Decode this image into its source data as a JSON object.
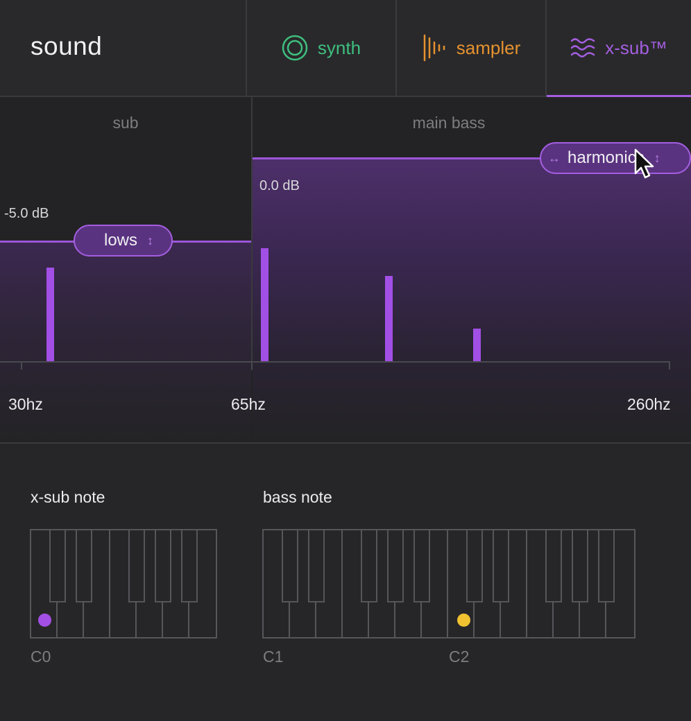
{
  "header": {
    "title": "sound",
    "tabs": [
      {
        "label": "synth",
        "icon": "concentric-circles-icon",
        "color": "#3fbf7f"
      },
      {
        "label": "sampler",
        "icon": "waveform-bars-icon",
        "color": "#e5922f"
      },
      {
        "label": "x-sub™",
        "icon": "waves-icon",
        "color": "#a45ee0",
        "active": true
      }
    ]
  },
  "spectrum": {
    "zones": {
      "sub": "sub",
      "main": "main bass"
    },
    "sub_level": "-5.0 dB",
    "main_level": "0.0 dB",
    "sub_handle": {
      "label": "lows",
      "arrow": "↕"
    },
    "main_handle": {
      "label": "harmonics",
      "left_arrow": "↔",
      "arrow": "↕"
    },
    "freq_labels": [
      "30hz",
      "65hz",
      "260hz"
    ],
    "accent": "#a24fe6"
  },
  "notes": {
    "xsub": {
      "title": "x-sub note",
      "octave_label": "C0",
      "selected_color": "#a24fe6"
    },
    "bass": {
      "title": "bass note",
      "octave_labels": [
        "C1",
        "C2"
      ],
      "selected_color": "#f0c231"
    }
  }
}
